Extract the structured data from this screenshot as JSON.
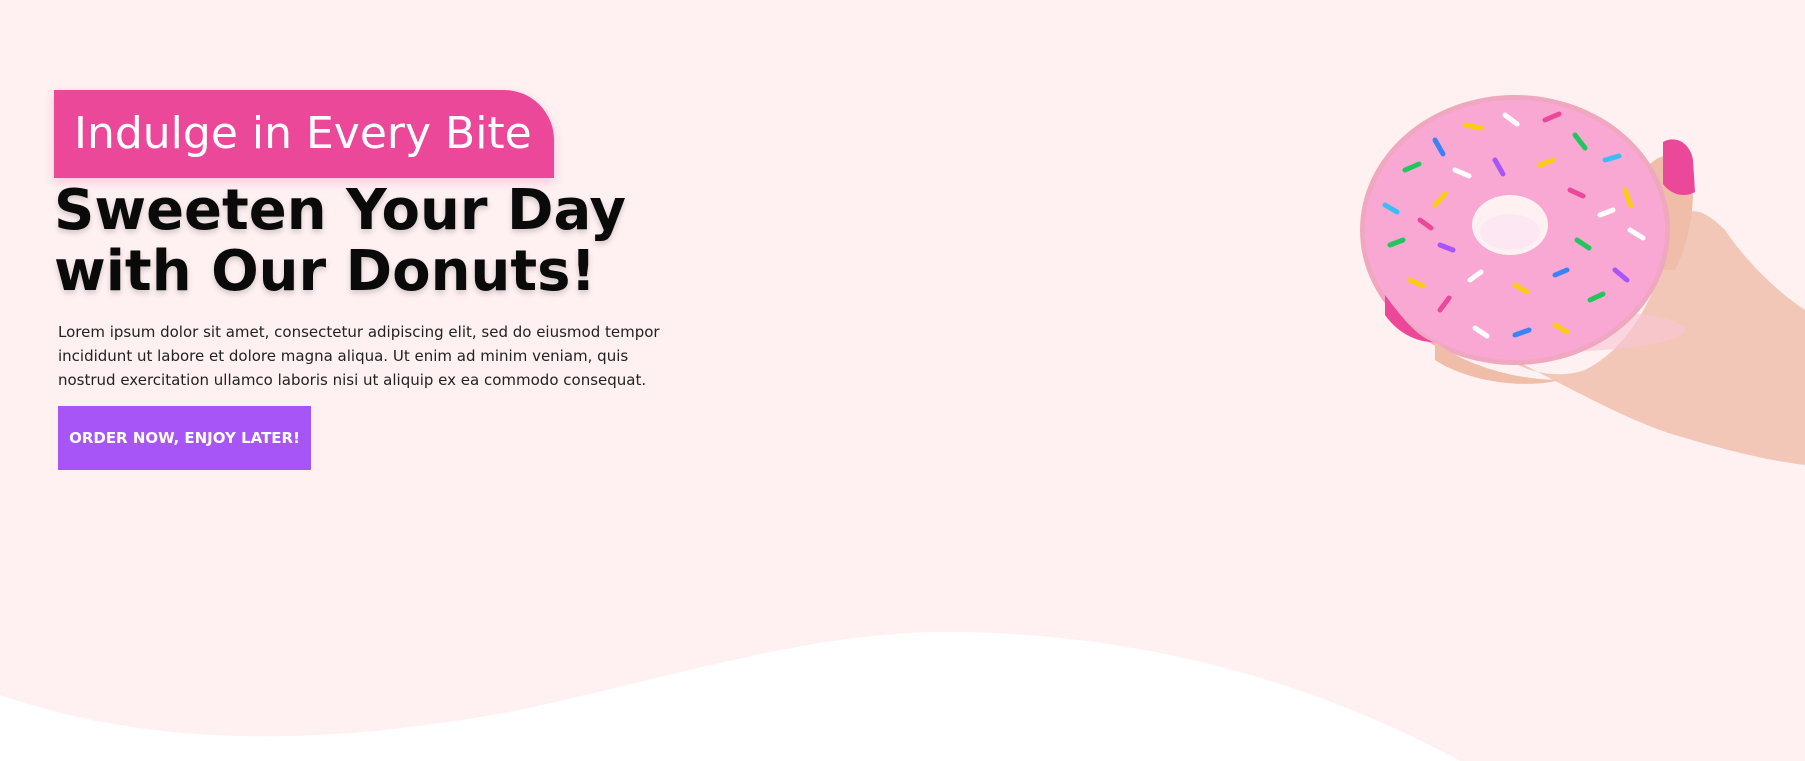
{
  "hero": {
    "badge_text": "Indulge in Every Bite",
    "headline": "Sweeten Your Day with Our Donuts!",
    "body": "Lorem ipsum dolor sit amet, consectetur adipiscing elit, sed do eiusmod tempor incididunt ut labore et dolore magna aliqua. Ut enim ad minim veniam, quis nostrud exercitation ullamco laboris nisi ut aliquip ex ea commodo consequat.",
    "cta_label": "ORDER NOW, ENJOY LATER!",
    "image": {
      "icon": "donut-in-hand-illustration"
    }
  },
  "colors": {
    "background": "#fff1f2",
    "badge": "#ec4899",
    "button": "#a855f7",
    "headline": "#0a0a0a",
    "wave": "#ffffff",
    "frosting": "#f9a8d4"
  }
}
